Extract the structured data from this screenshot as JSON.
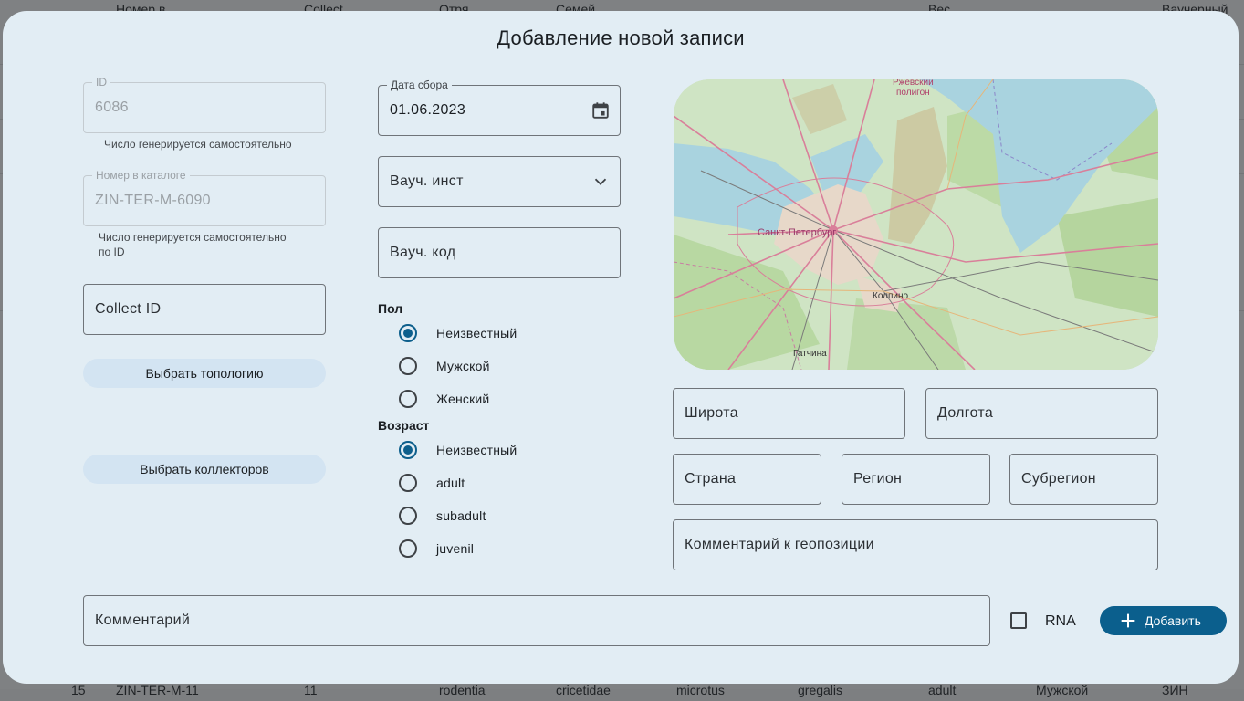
{
  "background_table": {
    "header": [
      "Номер в",
      "Collect",
      "Отря",
      "Семей",
      "Вес",
      "Ваучерный"
    ],
    "bottom_row": [
      "15",
      "ZIN-TER-M-11",
      "11",
      "rodentia",
      "cricetidae",
      "microtus",
      "gregalis",
      "adult",
      "Мужской",
      "ЗИН"
    ]
  },
  "dialog": {
    "title": "Добавление новой записи",
    "id_field": {
      "label": "ID",
      "value": "6086",
      "helper": "Число генерируется самостоятельно"
    },
    "catalog_field": {
      "label": "Номер в каталоге",
      "value": "ZIN-TER-M-6090",
      "helper_line1": "Число генерируется самостоятельно",
      "helper_line2": "по ID"
    },
    "collect_id": {
      "placeholder": "Collect ID"
    },
    "topology_button": "Выбрать топологию",
    "collectors_button": "Выбрать коллекторов",
    "date_field": {
      "label": "Дата сбора",
      "value": "01.06.2023",
      "icon": "calendar-icon"
    },
    "voucher_inst": {
      "placeholder": "Вауч. инст",
      "icon": "chevron-down-icon"
    },
    "voucher_code": {
      "placeholder": "Вауч. код"
    },
    "sex": {
      "label": "Пол",
      "options": [
        "Неизвестный",
        "Мужской",
        "Женский"
      ],
      "selected": "Неизвестный"
    },
    "age": {
      "label": "Возраст",
      "options": [
        "Неизвестный",
        "adult",
        "subadult",
        "juvenil"
      ],
      "selected": "Неизвестный"
    },
    "map": {
      "labels": {
        "city": "Санкт-Петербург",
        "kolpino": "Колпино",
        "gatchina": "Гатчина",
        "polygon_line1": "Ржевский",
        "polygon_line2": "полигон"
      },
      "colors": {
        "water": "#a9d3df",
        "land": "#cfe4c4",
        "forest": "#b3d59c",
        "urban": "#e7d8c9",
        "road": "#d97f9a"
      }
    },
    "latitude": {
      "placeholder": "Широта"
    },
    "longitude": {
      "placeholder": "Долгота"
    },
    "country": {
      "placeholder": "Страна"
    },
    "region": {
      "placeholder": "Регион"
    },
    "subregion": {
      "placeholder": "Субрегион"
    },
    "geo_comment": {
      "placeholder": "Комментарий к геопозиции"
    },
    "comment": {
      "placeholder": "Комментарий"
    },
    "rna": {
      "label": "RNA",
      "checked": false
    },
    "add_button": {
      "label": "Добавить",
      "icon": "plus-icon"
    },
    "accent_color": "#0b5f8d"
  }
}
